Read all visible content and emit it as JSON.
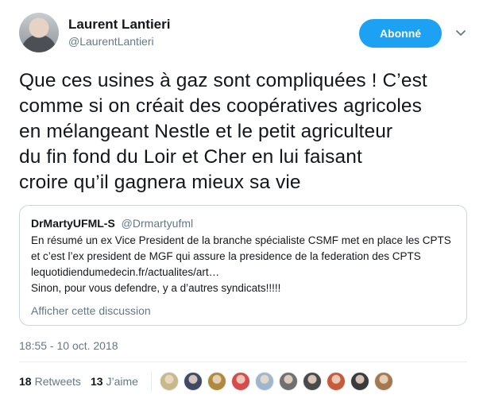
{
  "author": {
    "display_name": "Laurent Lantieri",
    "handle": "@LaurentLantieri"
  },
  "follow_button_label": "Abonné",
  "tweet": {
    "lines": [
      "Que ces usines à gaz sont compliquées ! C’est",
      "comme si on créait des coopératives agricoles",
      "en mélangeant Nestle et le petit agriculteur",
      "du fin fond du Loir et Cher en lui faisant",
      "croire qu’il gagnera mieux sa vie"
    ]
  },
  "quote": {
    "display_name": "DrMartyUFML-S",
    "handle": "@Drmartyufml",
    "lines": [
      "En résumé un ex Vice President de la branche spécialiste CSMF met en place les CPTS",
      "et c’est l’ex president de MGF qui assure la presidence de la federation des CPTS",
      "lequotidiendumedecin.fr/actualites/art…",
      "Sinon, pour vous defendre, y a d’autres syndicats!!!!!"
    ],
    "show_thread_label": "Afficher cette discussion"
  },
  "timestamp": "18:55 - 10 oct. 2018",
  "stats": {
    "retweets_count": "18",
    "retweets_label": "Retweets",
    "likes_count": "13",
    "likes_label": "J’aime"
  },
  "likers": [
    {
      "color": "#c8b98a"
    },
    {
      "color": "#3e4a66"
    },
    {
      "color": "#b08a3c"
    },
    {
      "color": "#d64c4c"
    },
    {
      "color": "#9fb6cf"
    },
    {
      "color": "#707070"
    },
    {
      "color": "#4a4a4a"
    },
    {
      "color": "#c65a3a"
    },
    {
      "color": "#3a3a3a"
    },
    {
      "color": "#a5794f"
    }
  ],
  "colors": {
    "accent": "#1da1f2",
    "text": "#14171a",
    "muted": "#657786"
  }
}
